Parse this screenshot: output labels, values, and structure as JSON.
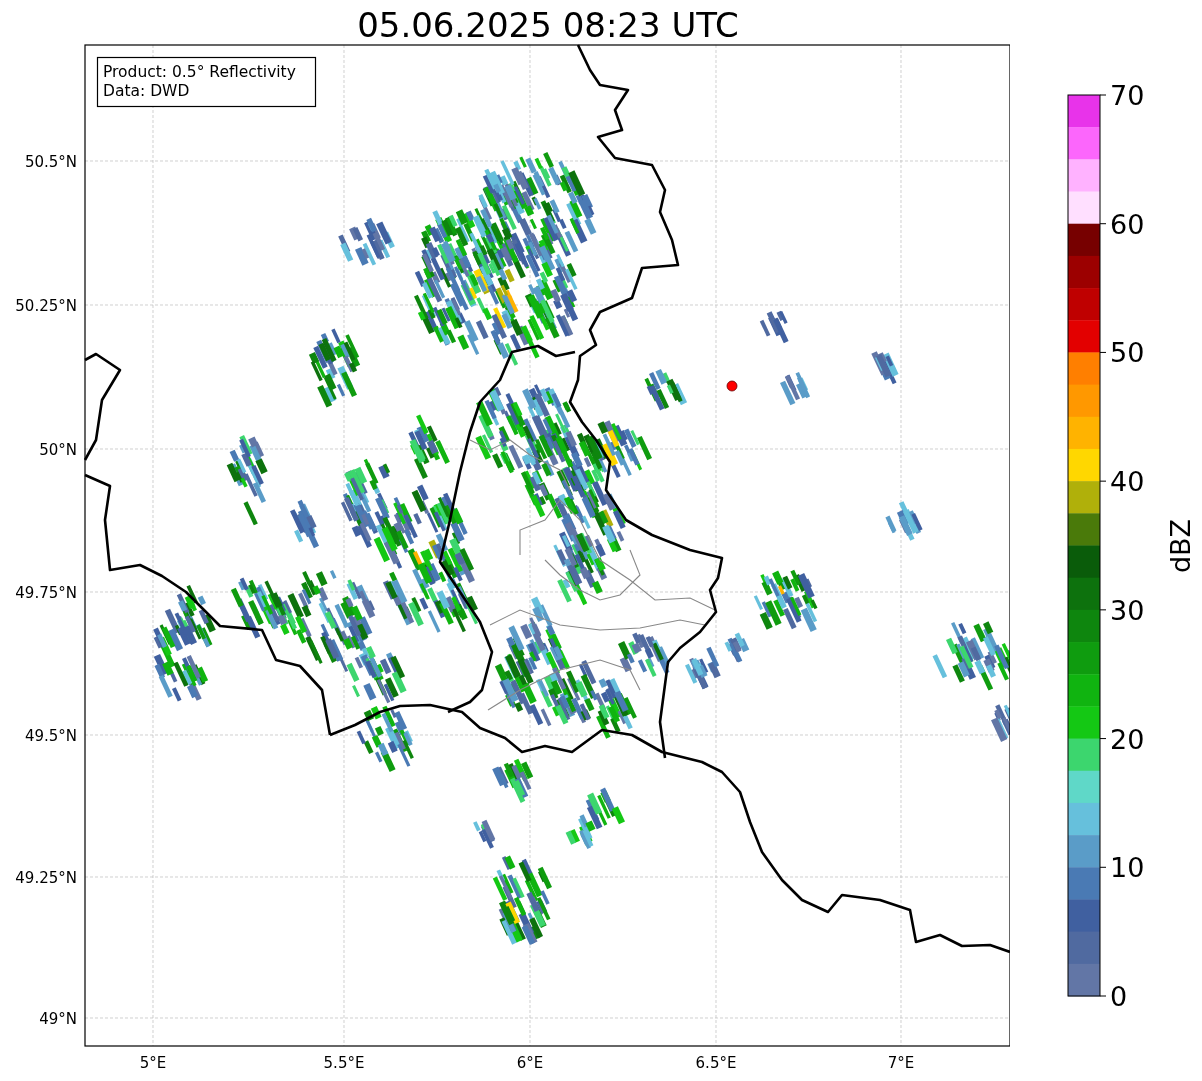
{
  "title": "05.06.2025 08:23 UTC",
  "info_box": [
    "Product: 0.5° Reflectivity",
    "Data: DWD"
  ],
  "x_ticks": [
    "5°E",
    "5.5°E",
    "6°E",
    "6.5°E",
    "7°E"
  ],
  "y_ticks": [
    "50.5°N",
    "50.25°N",
    "50°N",
    "49.75°N",
    "49.5°N",
    "49.25°N",
    "49°N"
  ],
  "colorbar": {
    "label": "dBZ",
    "ticks": [
      "70",
      "60",
      "50",
      "40",
      "30",
      "20",
      "10",
      "0"
    ],
    "bins": [
      {
        "color": "#e833ea"
      },
      {
        "color": "#fc66fc"
      },
      {
        "color": "#ffb2ff"
      },
      {
        "color": "#ffdfff"
      },
      {
        "color": "#770000"
      },
      {
        "color": "#9c0000"
      },
      {
        "color": "#bf0000"
      },
      {
        "color": "#e30000"
      },
      {
        "color": "#ff7f00"
      },
      {
        "color": "#ff9800"
      },
      {
        "color": "#ffb300"
      },
      {
        "color": "#ffd700"
      },
      {
        "color": "#b0b00a"
      },
      {
        "color": "#4a7a0a"
      },
      {
        "color": "#0a5c0a"
      },
      {
        "color": "#0d720d"
      },
      {
        "color": "#0e860e"
      },
      {
        "color": "#0f9c0f"
      },
      {
        "color": "#10b410"
      },
      {
        "color": "#14c814"
      },
      {
        "color": "#3cd66e"
      },
      {
        "color": "#5fd8c8"
      },
      {
        "color": "#66c0dc"
      },
      {
        "color": "#5a9cc8"
      },
      {
        "color": "#4a7ab4"
      },
      {
        "color": "#4060a0"
      },
      {
        "color": "#506aa0"
      },
      {
        "color": "#6276a6"
      }
    ]
  }
}
